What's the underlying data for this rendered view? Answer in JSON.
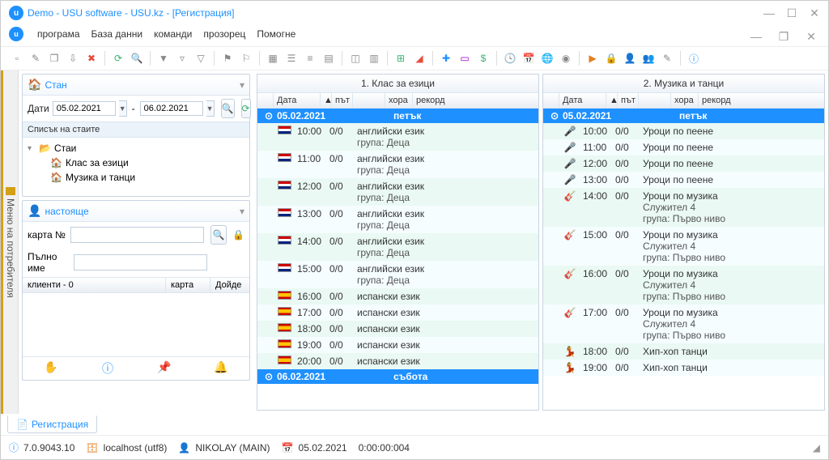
{
  "window": {
    "title": "Demo - USU software - USU.kz - [Регистрация]"
  },
  "menu": {
    "program": "програма",
    "database": "База данни",
    "commands": "команди",
    "window": "прозорец",
    "help": "Помогне"
  },
  "sidetab": {
    "label": "Меню на потребителя"
  },
  "rooms_pane": {
    "title": "Стан",
    "dates_label": "Дати",
    "date_from": "05.02.2021",
    "date_to": "06.02.2021",
    "list_label": "Списък на стаите",
    "root": "Стаи",
    "child1": "Клас за езици",
    "child2": "Музика и танци"
  },
  "present_pane": {
    "title": "настояще",
    "card_label": "карта №",
    "card_value": "",
    "fullname_label": "Пълно име",
    "fullname_value": "",
    "col_clients": "клиенти - 0",
    "col_card": "карта",
    "col_came": "Дойде"
  },
  "grid_headers": {
    "date": "Дата",
    "path": "път",
    "people": "хора",
    "record": "рекорд"
  },
  "grid1": {
    "title": "1. Клас за езици",
    "groups": [
      {
        "date": "05.02.2021",
        "day": "петък",
        "rows": [
          {
            "i": "en",
            "t": "10:00",
            "p": "0/0",
            "r": "английски език",
            "s": "група: Деца"
          },
          {
            "i": "en",
            "t": "11:00",
            "p": "0/0",
            "r": "английски език",
            "s": "група: Деца"
          },
          {
            "i": "en",
            "t": "12:00",
            "p": "0/0",
            "r": "английски език",
            "s": "група: Деца"
          },
          {
            "i": "en",
            "t": "13:00",
            "p": "0/0",
            "r": "английски език",
            "s": "група: Деца"
          },
          {
            "i": "en",
            "t": "14:00",
            "p": "0/0",
            "r": "английски език",
            "s": "група: Деца"
          },
          {
            "i": "en",
            "t": "15:00",
            "p": "0/0",
            "r": "английски език",
            "s": "група: Деца"
          },
          {
            "i": "es",
            "t": "16:00",
            "p": "0/0",
            "r": "испански език",
            "s": ""
          },
          {
            "i": "es",
            "t": "17:00",
            "p": "0/0",
            "r": "испански език",
            "s": ""
          },
          {
            "i": "es",
            "t": "18:00",
            "p": "0/0",
            "r": "испански език",
            "s": ""
          },
          {
            "i": "es",
            "t": "19:00",
            "p": "0/0",
            "r": "испански език",
            "s": ""
          },
          {
            "i": "es",
            "t": "20:00",
            "p": "0/0",
            "r": "испански език",
            "s": ""
          }
        ]
      },
      {
        "date": "06.02.2021",
        "day": "събота",
        "rows": []
      }
    ]
  },
  "grid2": {
    "title": "2. Музика и танци",
    "groups": [
      {
        "date": "05.02.2021",
        "day": "петък",
        "rows": [
          {
            "i": "s",
            "t": "10:00",
            "p": "0/0",
            "r": "Уроци по пеене",
            "s": ""
          },
          {
            "i": "s",
            "t": "11:00",
            "p": "0/0",
            "r": "Уроци по пеене",
            "s": ""
          },
          {
            "i": "s",
            "t": "12:00",
            "p": "0/0",
            "r": "Уроци по пеене",
            "s": ""
          },
          {
            "i": "s",
            "t": "13:00",
            "p": "0/0",
            "r": "Уроци по пеене",
            "s": ""
          },
          {
            "i": "g",
            "t": "14:00",
            "p": "0/0",
            "r": "Уроци по музика",
            "s": "Служител 4",
            "s2": "група: Първо ниво"
          },
          {
            "i": "g",
            "t": "15:00",
            "p": "0/0",
            "r": "Уроци по музика",
            "s": "Служител 4",
            "s2": "група: Първо ниво"
          },
          {
            "i": "g",
            "t": "16:00",
            "p": "0/0",
            "r": "Уроци по музика",
            "s": "Служител 4",
            "s2": "група: Първо ниво"
          },
          {
            "i": "g",
            "t": "17:00",
            "p": "0/0",
            "r": "Уроци по музика",
            "s": "Служител 4",
            "s2": "група: Първо ниво"
          },
          {
            "i": "d",
            "t": "18:00",
            "p": "0/0",
            "r": "Хип-хоп танци",
            "s": ""
          },
          {
            "i": "d",
            "t": "19:00",
            "p": "0/0",
            "r": "Хип-хоп танци",
            "s": ""
          }
        ]
      }
    ]
  },
  "footer_tab": "Регистрация",
  "status": {
    "version": "7.0.9043.10",
    "host": "localhost (utf8)",
    "user": "NIKOLAY (MAIN)",
    "date": "05.02.2021",
    "elapsed": "0:00:00:004"
  }
}
